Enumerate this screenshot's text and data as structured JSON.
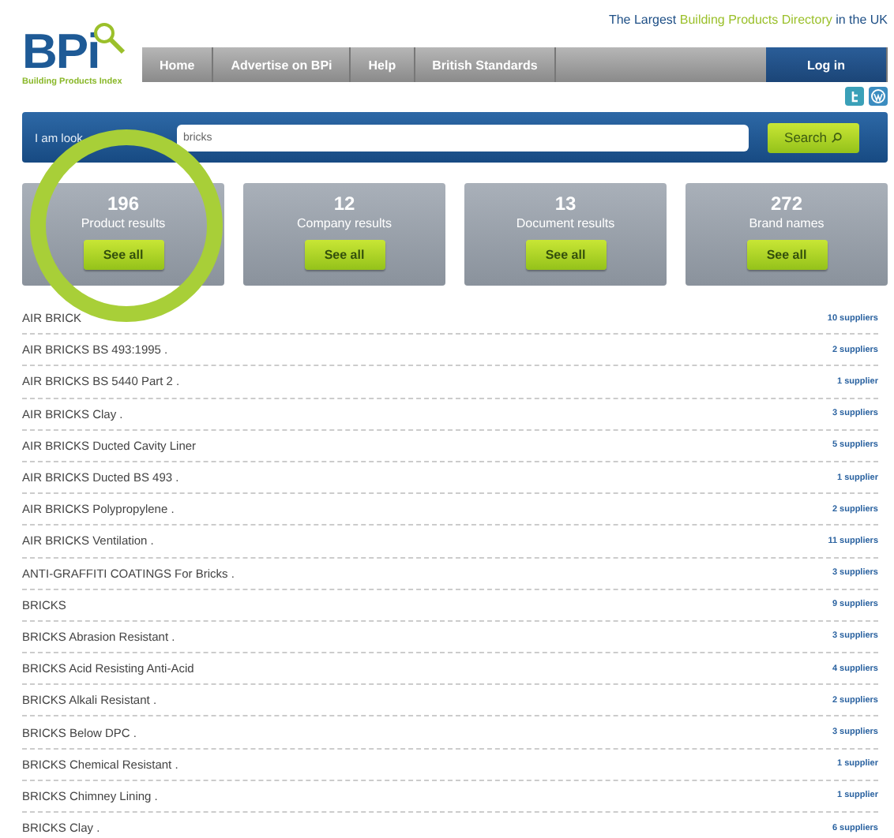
{
  "tagline": {
    "before": "The Largest ",
    "highlight": "Building Products Directory",
    "after": " in the UK"
  },
  "logo": {
    "letters": "BP",
    "i": "i",
    "subtitle": "Building Products Index"
  },
  "nav": [
    {
      "label": "Home"
    },
    {
      "label": "Advertise on BPi"
    },
    {
      "label": "Help"
    },
    {
      "label": "British Standards"
    }
  ],
  "login": "Log in",
  "search": {
    "label": "I am look",
    "value": "bricks",
    "button": "Search"
  },
  "cards": [
    {
      "count": "196",
      "label": "Product results",
      "button": "See all"
    },
    {
      "count": "12",
      "label": "Company results",
      "button": "See all"
    },
    {
      "count": "13",
      "label": "Document results",
      "button": "See all"
    },
    {
      "count": "272",
      "label": "Brand names",
      "button": "See all"
    }
  ],
  "results": [
    {
      "name": "AIR BRICK",
      "suppliers": "10 suppliers"
    },
    {
      "name": "AIR BRICKS BS 493:1995 .",
      "suppliers": "2 suppliers"
    },
    {
      "name": "AIR BRICKS BS 5440 Part 2 .",
      "suppliers": "1 supplier"
    },
    {
      "name": "AIR BRICKS Clay .",
      "suppliers": "3 suppliers"
    },
    {
      "name": "AIR BRICKS Ducted Cavity Liner",
      "suppliers": "5 suppliers"
    },
    {
      "name": "AIR BRICKS Ducted BS 493 .",
      "suppliers": "1 supplier"
    },
    {
      "name": "AIR BRICKS Polypropylene .",
      "suppliers": "2 suppliers"
    },
    {
      "name": "AIR BRICKS Ventilation .",
      "suppliers": "11 suppliers"
    },
    {
      "name": "ANTI-GRAFFITI COATINGS For Bricks .",
      "suppliers": "3 suppliers"
    },
    {
      "name": "BRICKS",
      "suppliers": "9 suppliers"
    },
    {
      "name": "BRICKS Abrasion Resistant .",
      "suppliers": "3 suppliers"
    },
    {
      "name": "BRICKS Acid Resisting Anti-Acid",
      "suppliers": "4 suppliers"
    },
    {
      "name": "BRICKS Alkali Resistant .",
      "suppliers": "2 suppliers"
    },
    {
      "name": "BRICKS Below DPC .",
      "suppliers": "3 suppliers"
    },
    {
      "name": "BRICKS Chemical Resistant .",
      "suppliers": "1 supplier"
    },
    {
      "name": "BRICKS Chimney Lining .",
      "suppliers": "1 supplier"
    },
    {
      "name": "BRICKS Clay .",
      "suppliers": "6 suppliers"
    }
  ]
}
